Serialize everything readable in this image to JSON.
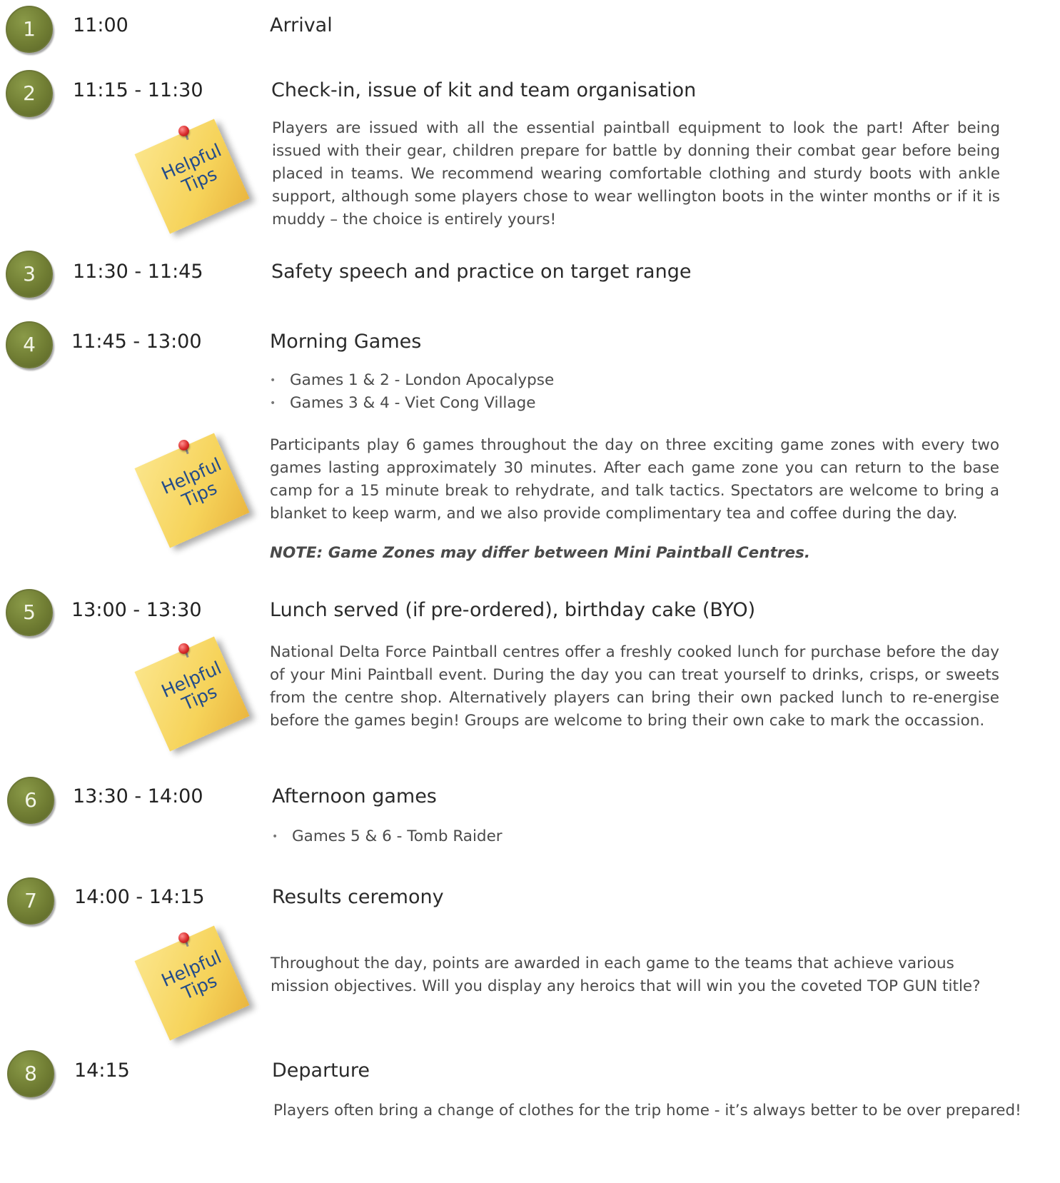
{
  "tips_label": {
    "line1": "Helpful",
    "line2": "Tips"
  },
  "steps": [
    {
      "number": "1",
      "time": "11:00",
      "title": "Arrival"
    },
    {
      "number": "2",
      "time": "11:15 - 11:30",
      "title": "Check-in, issue of kit and team organisation",
      "description": "Players are issued with all the essential paintball equipment to look the part! After being issued with their gear, children prepare for battle by donning their combat gear before being placed in teams. We recommend wearing comfortable clothing and sturdy boots with ankle support, although some players chose to wear wellington boots in the winter months or if it is muddy – the choice is entirely yours!"
    },
    {
      "number": "3",
      "time": "11:30 - 11:45",
      "title": "Safety speech and practice on target range"
    },
    {
      "number": "4",
      "time": "11:45 - 13:00",
      "title": "Morning Games",
      "bullets": [
        "Games 1 & 2 - London Apocalypse",
        "Games 3 & 4 - Viet Cong Village"
      ],
      "description": "Participants play 6 games throughout the day on three exciting game zones with every two games lasting approximately 30 minutes. After each game zone you can return to the base camp for a 15 minute break to rehydrate, and talk tactics. Spectators are welcome to bring a blanket to keep warm, and we also provide complimentary tea and coffee during the day.",
      "note": "NOTE: Game Zones may differ between Mini Paintball Centres."
    },
    {
      "number": "5",
      "time": "13:00 - 13:30",
      "title": "Lunch served (if pre-ordered), birthday cake (BYO)",
      "description": "National Delta Force Paintball centres offer a freshly cooked lunch for purchase before the day of your Mini Paintball event. During the day you can treat yourself to drinks, crisps, or sweets from the centre shop. Alternatively players can bring their own packed lunch to re-energise before the games begin! Groups are welcome to bring their own cake to mark the occassion."
    },
    {
      "number": "6",
      "time": "13:30 - 14:00",
      "title": "Afternoon games",
      "bullets": [
        "Games 5 & 6 - Tomb Raider"
      ]
    },
    {
      "number": "7",
      "time": "14:00 - 14:15",
      "title": "Results ceremony",
      "description": "Throughout the day, points are awarded in each game to the teams that achieve various mission objectives. Will you display any heroics that will win you the coveted TOP GUN title?"
    },
    {
      "number": "8",
      "time": "14:15",
      "title": "Departure",
      "description": "Players often bring a change of clothes for the trip home - it’s always better to be over prepared!"
    }
  ],
  "colors": {
    "circle": "#707d33",
    "tips_text": "#234c8a",
    "note_paper": "#f6d35a"
  }
}
